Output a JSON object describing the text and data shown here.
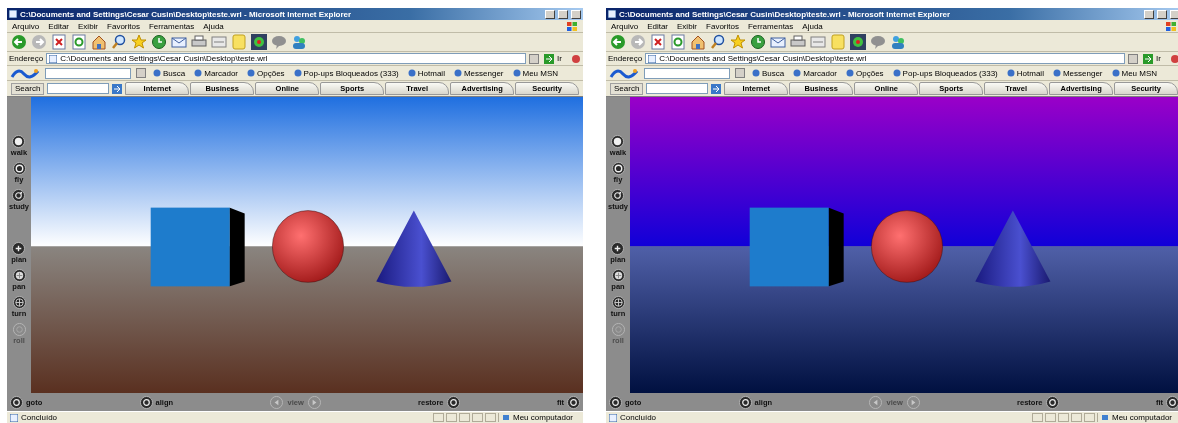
{
  "windows": [
    {
      "title": "C:\\Documents and Settings\\Cesar Cusin\\Desktop\\teste.wrl - Microsoft Internet Explorer",
      "menu": [
        "Arquivo",
        "Editar",
        "Exibir",
        "Favoritos",
        "Ferramentas",
        "Ajuda"
      ],
      "address_label": "Endereço",
      "address": "C:\\Documents and Settings\\Cesar Cusin\\Desktop\\teste.wrl",
      "go_label": "Ir",
      "msn_links": [
        "Busca",
        "Marcador",
        "Opções",
        "Pop-ups Bloqueados (333)",
        "Hotmail",
        "Messenger",
        "Meu MSN"
      ],
      "search_label": "Search",
      "tabs": [
        "Internet",
        "Business",
        "Online",
        "Sports",
        "Travel",
        "Advertising",
        "Security"
      ],
      "nav_buttons": [
        {
          "label": "walk",
          "disabled": false
        },
        {
          "label": "fly",
          "disabled": false
        },
        {
          "label": "study",
          "disabled": false
        },
        {
          "label": "plan",
          "disabled": false
        },
        {
          "label": "pan",
          "disabled": false
        },
        {
          "label": "turn",
          "disabled": false
        },
        {
          "label": "roll",
          "disabled": true
        }
      ],
      "bottom_controls": [
        {
          "kind": "icon-left",
          "label": "goto",
          "disabled": false
        },
        {
          "kind": "icon-left",
          "label": "align",
          "disabled": false
        },
        {
          "kind": "pair",
          "label": "view",
          "disabled": true
        },
        {
          "kind": "icon-right",
          "label": "restore",
          "disabled": false
        },
        {
          "kind": "icon-right",
          "label": "fit",
          "disabled": false
        }
      ],
      "status_text": "Concluído",
      "zone_text": "Meu computador"
    },
    {
      "title": "C:\\Documents and Settings\\Cesar Cusin\\Desktop\\teste.wrl - Microsoft Internet Explorer",
      "menu": [
        "Arquivo",
        "Editar",
        "Exibir",
        "Favoritos",
        "Ferramentas",
        "Ajuda"
      ],
      "address_label": "Endereço",
      "address": "C:\\Documents and Settings\\Cesar Cusin\\Desktop\\teste.wrl",
      "go_label": "Ir",
      "msn_links": [
        "Busca",
        "Marcador",
        "Opções",
        "Pop-ups Bloqueados (333)",
        "Hotmail",
        "Messenger",
        "Meu MSN"
      ],
      "search_label": "Search",
      "tabs": [
        "Internet",
        "Business",
        "Online",
        "Sports",
        "Travel",
        "Advertising",
        "Security"
      ],
      "nav_buttons": [
        {
          "label": "walk",
          "disabled": false
        },
        {
          "label": "fly",
          "disabled": false
        },
        {
          "label": "study",
          "disabled": false
        },
        {
          "label": "plan",
          "disabled": false
        },
        {
          "label": "pan",
          "disabled": false
        },
        {
          "label": "turn",
          "disabled": false
        },
        {
          "label": "roll",
          "disabled": true
        }
      ],
      "bottom_controls": [
        {
          "kind": "icon-left",
          "label": "goto",
          "disabled": false
        },
        {
          "kind": "icon-left",
          "label": "align",
          "disabled": false
        },
        {
          "kind": "pair",
          "label": "view",
          "disabled": true
        },
        {
          "kind": "icon-right",
          "label": "restore",
          "disabled": false
        },
        {
          "kind": "icon-right",
          "label": "fit",
          "disabled": false
        }
      ],
      "status_text": "Concluído",
      "zone_text": "Meu computador"
    }
  ]
}
